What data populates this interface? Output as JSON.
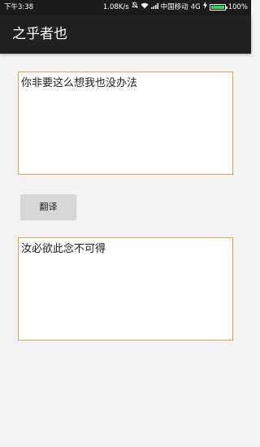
{
  "status_bar": {
    "time": "下午3:38",
    "speed": "1.08K/s",
    "carrier": "中国移动",
    "network": "4G",
    "battery": "100%",
    "battery_level": 1.0,
    "battery_color": "#34d35a"
  },
  "app_bar": {
    "title": "之乎者也"
  },
  "input": {
    "text": "你非要这么想我也没办法"
  },
  "translate_button": {
    "label": "翻译"
  },
  "output": {
    "text": "汝必欲此念不可得"
  },
  "colors": {
    "border": "#d6a94e",
    "app_bar": "#212121",
    "background": "#f2f2f2"
  }
}
